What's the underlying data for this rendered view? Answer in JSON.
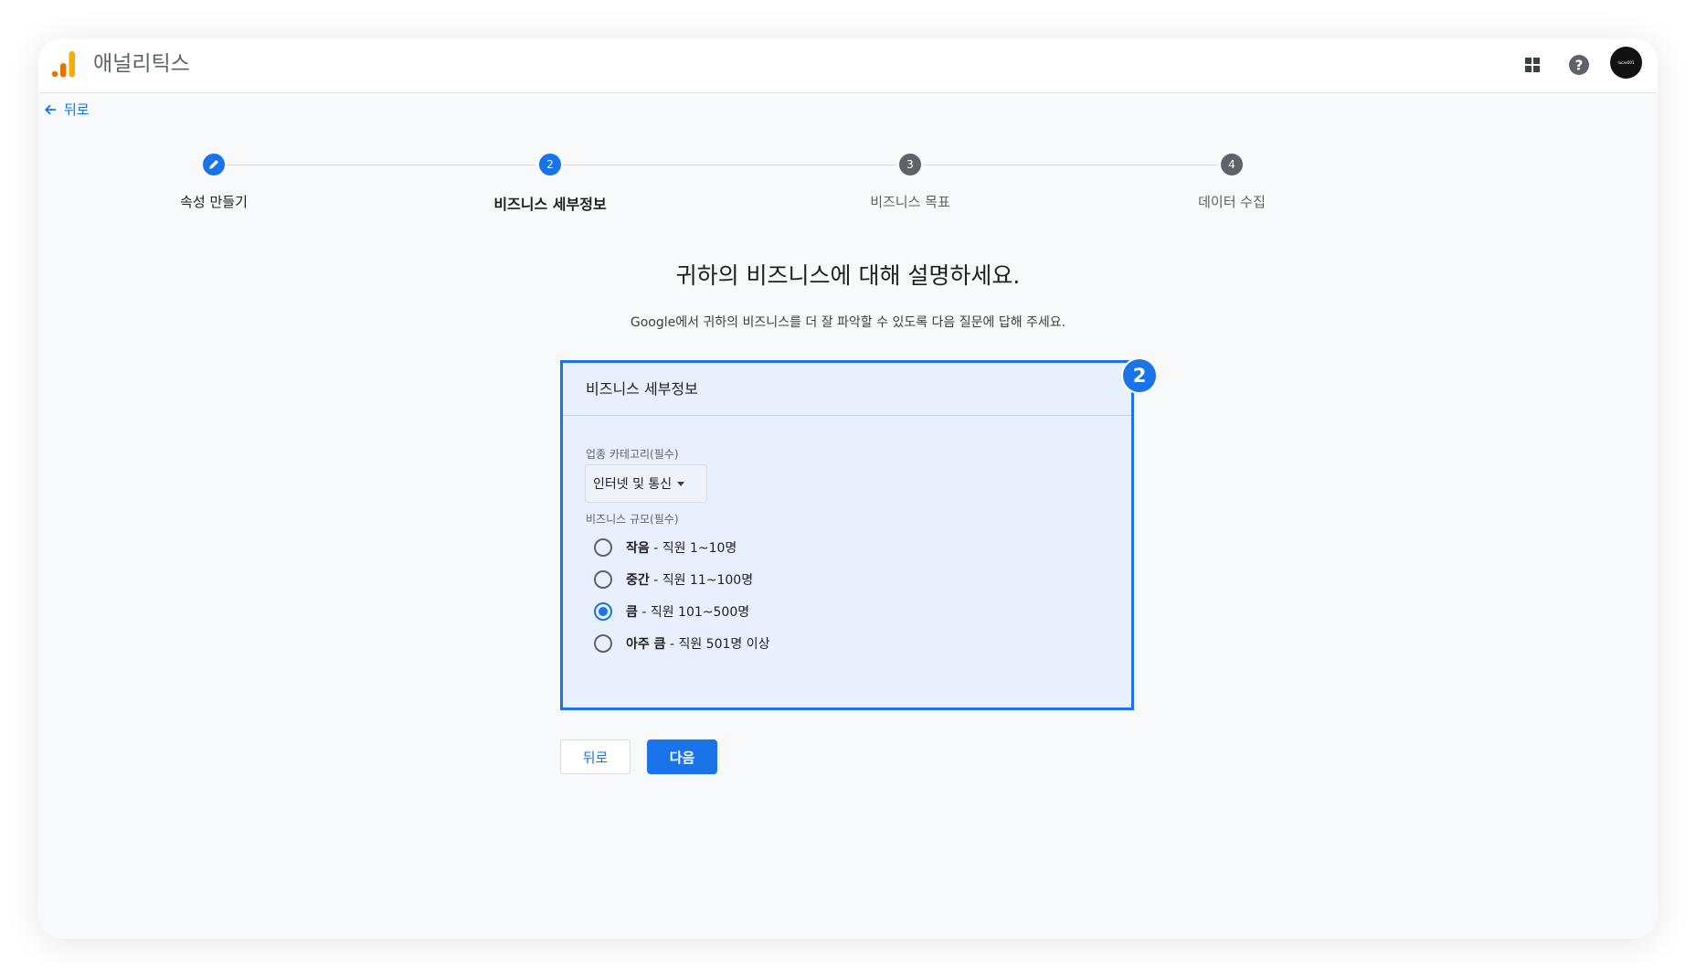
{
  "app": {
    "title": "애널리틱스",
    "logo_icon": "analytics-bars-icon",
    "brand_colors": [
      "#f9ab00",
      "#e37400"
    ]
  },
  "topbar": {
    "apps_icon": "apps-grid-icon",
    "help_icon": "help-icon",
    "avatar_text": "lucas001"
  },
  "nav": {
    "back_label": "뒤로"
  },
  "stepper": {
    "steps": [
      {
        "label": "속성 만들기",
        "marker": "",
        "state": "done"
      },
      {
        "label": "비즈니스 세부정보",
        "marker": "2",
        "state": "active"
      },
      {
        "label": "비즈니스 목표",
        "marker": "3",
        "state": "todo"
      },
      {
        "label": "데이터 수집",
        "marker": "4",
        "state": "todo"
      }
    ]
  },
  "main": {
    "heading": "귀하의 비즈니스에 대해 설명하세요.",
    "subheading": "Google에서 귀하의 비즈니스를 더 잘 파악할 수 있도록 다음 질문에 답해 주세요."
  },
  "card": {
    "title": "비즈니스 세부정보",
    "badge": "2",
    "industry": {
      "label": "업종 카테고리(필수)",
      "value": "인터넷 및 통신"
    },
    "size": {
      "label": "비즈니스 규모(필수)",
      "options": [
        {
          "bold": "작음",
          "rest": " - 직원 1~10명",
          "checked": false
        },
        {
          "bold": "중간",
          "rest": " - 직원 11~100명",
          "checked": false
        },
        {
          "bold": "큼",
          "rest": " - 직원 101~500명",
          "checked": true
        },
        {
          "bold": "아주 큼",
          "rest": " - 직원 501명 이상",
          "checked": false
        }
      ]
    }
  },
  "actions": {
    "back_label": "뒤로",
    "next_label": "다음"
  },
  "colors": {
    "accent": "#1a73e8",
    "step_inactive": "#5f6368"
  }
}
